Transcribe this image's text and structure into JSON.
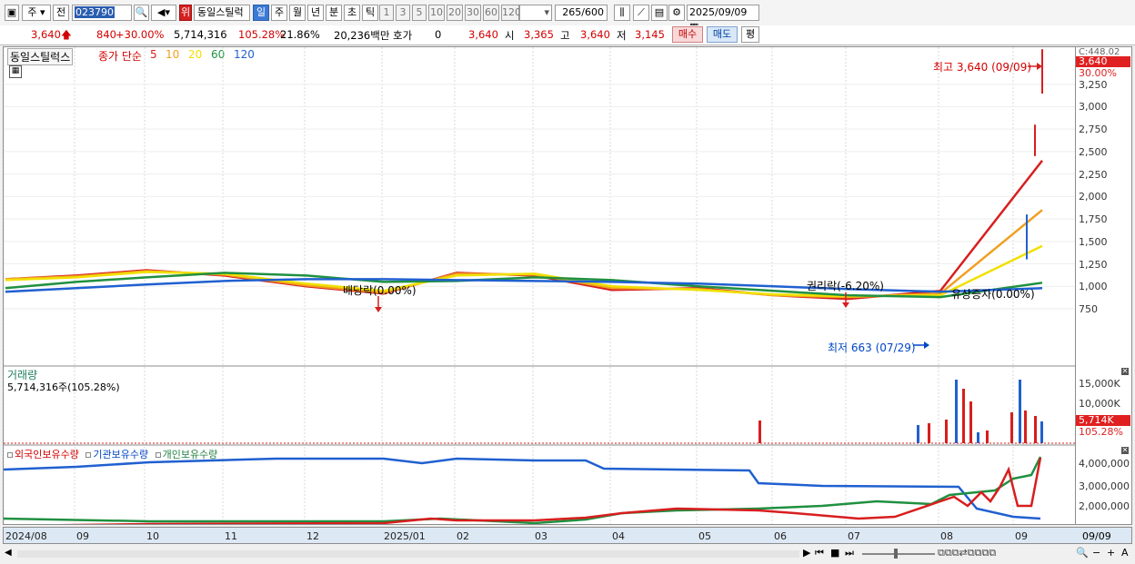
{
  "toolbar": {
    "type_select": "주",
    "prev_button": "전",
    "code": "023790",
    "stock_name_tag": "위",
    "stock_name": "동일스틸럭",
    "periods": [
      "일",
      "주",
      "월",
      "년",
      "분",
      "초",
      "틱"
    ],
    "active_period": "일",
    "intervals": [
      "1",
      "3",
      "5",
      "10",
      "20",
      "30",
      "60",
      "120"
    ],
    "count": "265",
    "count_max": "/600",
    "date": "2025/09/09"
  },
  "info": {
    "price": "3,640",
    "change": "840",
    "change_pct": "+30.00%",
    "volume": "5,714,316",
    "volume_ratio": "105.28%",
    "turnover": "21.86%",
    "amount": "20,236백만",
    "hoga_label": "호가",
    "hoga_value": "0",
    "current": "3,640",
    "open_label": "시",
    "open": "3,365",
    "high_label": "고",
    "high": "3,640",
    "low_label": "저",
    "low": "3,145",
    "buy_button": "매수",
    "sell_button": "매도",
    "eval_button": "평"
  },
  "price_panel": {
    "stock_label": "동일스틸럭스",
    "ma_label": "종가 단순",
    "ma_periods": [
      {
        "label": "5",
        "color": "#d81e1e"
      },
      {
        "label": "10",
        "color": "#f0a020"
      },
      {
        "label": "20",
        "color": "#f0e000"
      },
      {
        "label": "60",
        "color": "#209040"
      },
      {
        "label": "120",
        "color": "#2060d0"
      }
    ],
    "annotations": {
      "high": "최고 3,640 (09/09)",
      "dividend": "배당락(0.00%)",
      "rights": "권리락(-6.20%)",
      "capital": "유상증자(0.00%)",
      "low": "최저 663 (07/29)"
    },
    "top_right_label": "C:448.02",
    "current_price_tag": "3,640",
    "current_pct_tag": "30.00%",
    "y_ticks": [
      "3,250",
      "3,000",
      "2,750",
      "2,500",
      "2,250",
      "2,000",
      "1,750",
      "1,500",
      "1,250",
      "1,000",
      "750"
    ]
  },
  "volume_panel": {
    "title": "거래량",
    "value": "5,714,316주(105.28%)",
    "y_ticks": [
      "15,000K",
      "10,000K"
    ],
    "current_tag": "5,714K",
    "current_pct": "105.28%"
  },
  "holding_panel": {
    "legend": [
      {
        "label": "외국인보유수량",
        "color": "#d81e1e"
      },
      {
        "label": "기관보유수량",
        "color": "#2060d0"
      },
      {
        "label": "개인보유수량",
        "color": "#209040"
      }
    ],
    "y_ticks": [
      "4,000,000",
      "3,000,000",
      "2,000,000"
    ]
  },
  "x_axis": {
    "labels": [
      "2024/08",
      "09",
      "10",
      "11",
      "12",
      "2025/01",
      "02",
      "03",
      "04",
      "05",
      "06",
      "07",
      "08",
      "09"
    ],
    "right_label": "09/09"
  },
  "chart_data": {
    "type": "line",
    "title": "동일스틸럭스",
    "x": [
      "2024/08",
      "2024/09",
      "2024/10",
      "2024/11",
      "2024/12",
      "2025/01",
      "2025/02",
      "2025/03",
      "2025/04",
      "2025/05",
      "2025/06",
      "2025/07",
      "2025/08",
      "2025/09"
    ],
    "series": [
      {
        "name": "5",
        "values": [
          1080,
          1120,
          1180,
          1120,
          1000,
          920,
          1150,
          1120,
          960,
          980,
          900,
          860,
          950,
          2400
        ]
      },
      {
        "name": "10",
        "values": [
          1080,
          1110,
          1170,
          1130,
          1010,
          930,
          1140,
          1130,
          980,
          970,
          900,
          880,
          920,
          1850
        ]
      },
      {
        "name": "20",
        "values": [
          1070,
          1100,
          1160,
          1140,
          1030,
          950,
          1120,
          1140,
          1000,
          960,
          910,
          890,
          900,
          1450
        ]
      },
      {
        "name": "60",
        "values": [
          980,
          1050,
          1100,
          1150,
          1120,
          1050,
          1060,
          1100,
          1070,
          1000,
          950,
          900,
          880,
          1040
        ]
      },
      {
        "name": "120",
        "values": [
          940,
          980,
          1020,
          1060,
          1080,
          1080,
          1070,
          1060,
          1050,
          1030,
          1000,
          970,
          940,
          980
        ]
      }
    ],
    "ylim": [
      600,
      3500
    ],
    "annotations": [
      "최고 3,640 (09/09)",
      "최저 663 (07/29)",
      "배당락(0.00%)",
      "권리락(-6.20%)",
      "유상증자(0.00%)"
    ]
  }
}
